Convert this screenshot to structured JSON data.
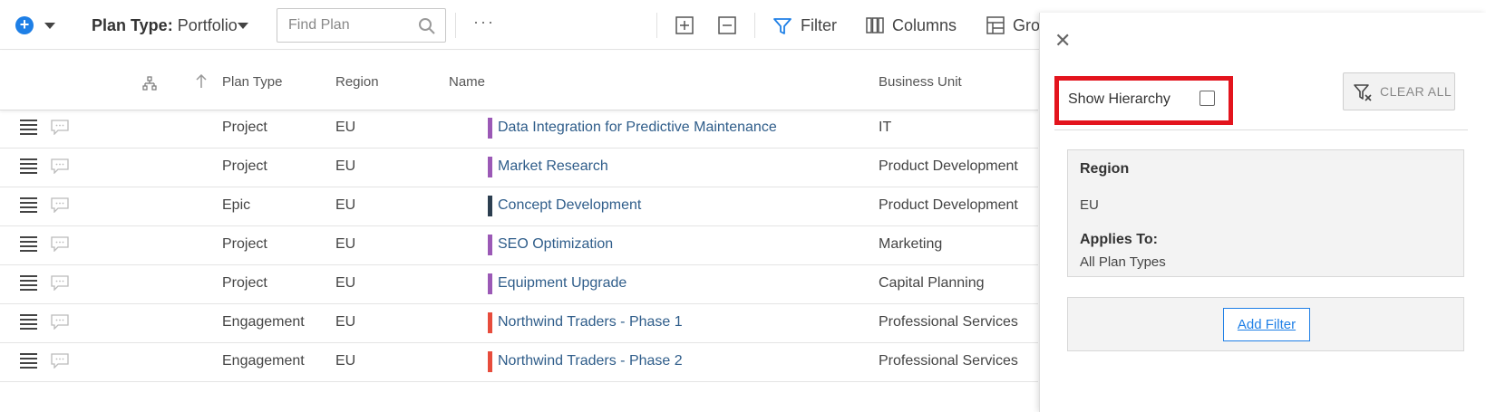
{
  "toolbar": {
    "plan_type_label": "Plan Type:",
    "plan_type_value": "Portfolio",
    "search_placeholder": "Find Plan",
    "more": "···",
    "filter_label": "Filter",
    "columns_label": "Columns",
    "group_label": "Gro"
  },
  "grid": {
    "headers": {
      "plan_type": "Plan Type",
      "region": "Region",
      "name": "Name",
      "business_unit": "Business Unit"
    },
    "rows": [
      {
        "plan_type": "Project",
        "region": "EU",
        "name": "Data Integration for Predictive Maintenance",
        "business_unit": "IT",
        "color": "#9b59b6"
      },
      {
        "plan_type": "Project",
        "region": "EU",
        "name": "Market Research",
        "business_unit": "Product Development",
        "color": "#9b59b6"
      },
      {
        "plan_type": "Epic",
        "region": "EU",
        "name": "Concept Development",
        "business_unit": "Product Development",
        "color": "#2c3e50"
      },
      {
        "plan_type": "Project",
        "region": "EU",
        "name": "SEO Optimization",
        "business_unit": "Marketing",
        "color": "#9b59b6"
      },
      {
        "plan_type": "Project",
        "region": "EU",
        "name": "Equipment Upgrade",
        "business_unit": "Capital Planning",
        "color": "#9b59b6"
      },
      {
        "plan_type": "Engagement",
        "region": "EU",
        "name": "Northwind Traders - Phase 1",
        "business_unit": "Professional Services",
        "color": "#e74c3c"
      },
      {
        "plan_type": "Engagement",
        "region": "EU",
        "name": "Northwind Traders - Phase 2",
        "business_unit": "Professional Services",
        "color": "#e74c3c"
      }
    ]
  },
  "panel": {
    "show_hierarchy_label": "Show Hierarchy",
    "show_hierarchy_checked": false,
    "clear_all_label": "CLEAR ALL",
    "filter": {
      "title": "Region",
      "value": "EU",
      "applies_label": "Applies To:",
      "applies_value": "All Plan Types"
    },
    "add_filter_label": "Add Filter"
  },
  "colors": {
    "accent": "#1e7fe6",
    "highlight": "#e3141d"
  }
}
